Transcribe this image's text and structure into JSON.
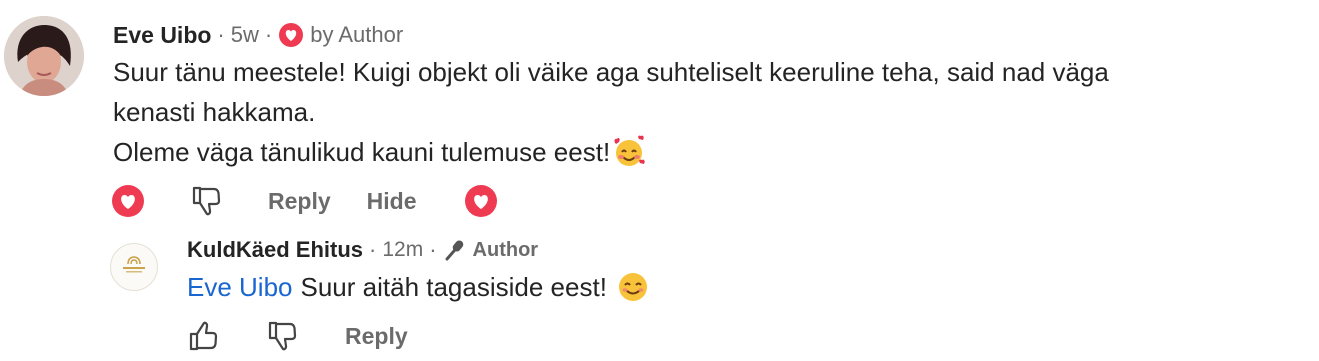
{
  "comment": {
    "author": "Eve Uibo",
    "age": "5w",
    "by_author": "by Author",
    "lines": [
      "Suur tänu meestele! Kuigi objekt oli väike aga suhteliselt keeruline teha, said nad väga",
      "kenasti hakkama.",
      "Oleme väga tänulikud kauni tulemuse eest!"
    ],
    "emoji": "smiling-face-with-hearts",
    "actions": {
      "reply": "Reply",
      "hide": "Hide"
    }
  },
  "reply": {
    "author": "KuldKäed Ehitus",
    "age": "12m",
    "badge": "Author",
    "mention": "Eve Uibo",
    "text": "Suur aitäh tagasiside eest!",
    "emoji": "smiling-face",
    "actions": {
      "reply": "Reply"
    }
  },
  "colors": {
    "heart": "#ef3b52",
    "mention": "#1a66d1",
    "meta": "#6b6b6b"
  }
}
